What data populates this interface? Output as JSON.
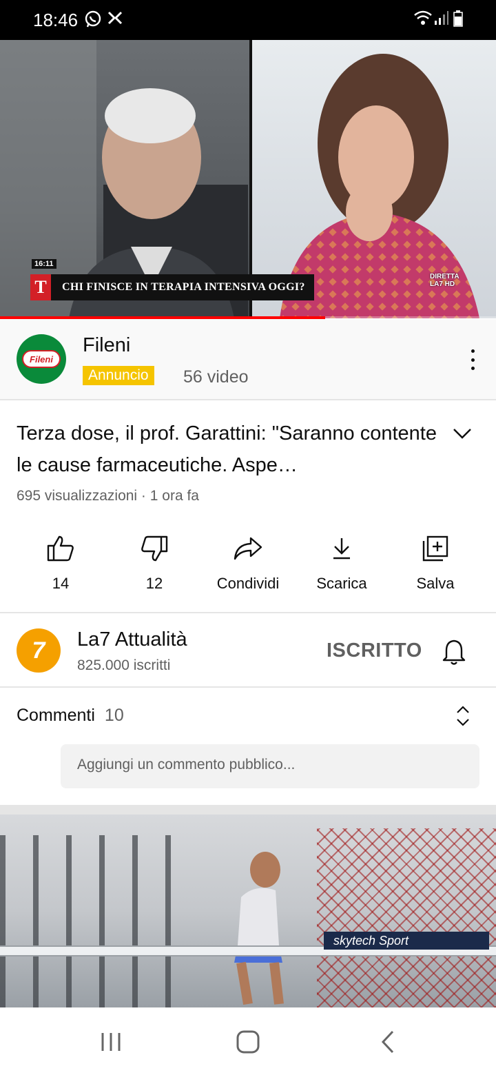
{
  "status_bar": {
    "time": "18:46",
    "icons": [
      "whatsapp-icon",
      "notification-icon",
      "wifi-icon",
      "signal-icon",
      "battery-icon"
    ]
  },
  "player": {
    "time_badge": "16:11",
    "chyron_logo": "T",
    "chyron_text": "CHI FINISCE IN TERAPIA INTENSIVA OGGI?",
    "network_bug_line1": "DIRETTA",
    "network_bug_line2": "LA7 HD",
    "progress_fraction": 0.655
  },
  "ad": {
    "logo_text": "Fileni",
    "name": "Fileni",
    "badge": "Annuncio",
    "video_count": "56 video"
  },
  "video": {
    "title": "Terza dose, il prof. Garattini: \"Saranno contente le cause farmaceutiche. Aspe…",
    "meta": "695 visualizzazioni · 1 ora fa"
  },
  "actions": {
    "like": "14",
    "dislike": "12",
    "share": "Condividi",
    "download": "Scarica",
    "save": "Salva"
  },
  "channel": {
    "avatar_text": "7",
    "name": "La7 Attualità",
    "subscribers": "825.000 iscritti",
    "subscribe_state": "ISCRITTO"
  },
  "comments": {
    "label": "Commenti",
    "count": "10",
    "placeholder": "Aggiungi un commento pubblico..."
  },
  "next_video": {
    "banner_text": "skytech Sport"
  },
  "colors": {
    "progress": "#ff0000",
    "ad_badge": "#f5c400",
    "ad_logo_bg": "#0a8a3a",
    "channel_avatar": "#f5a000",
    "chyron_red": "#d32027"
  }
}
